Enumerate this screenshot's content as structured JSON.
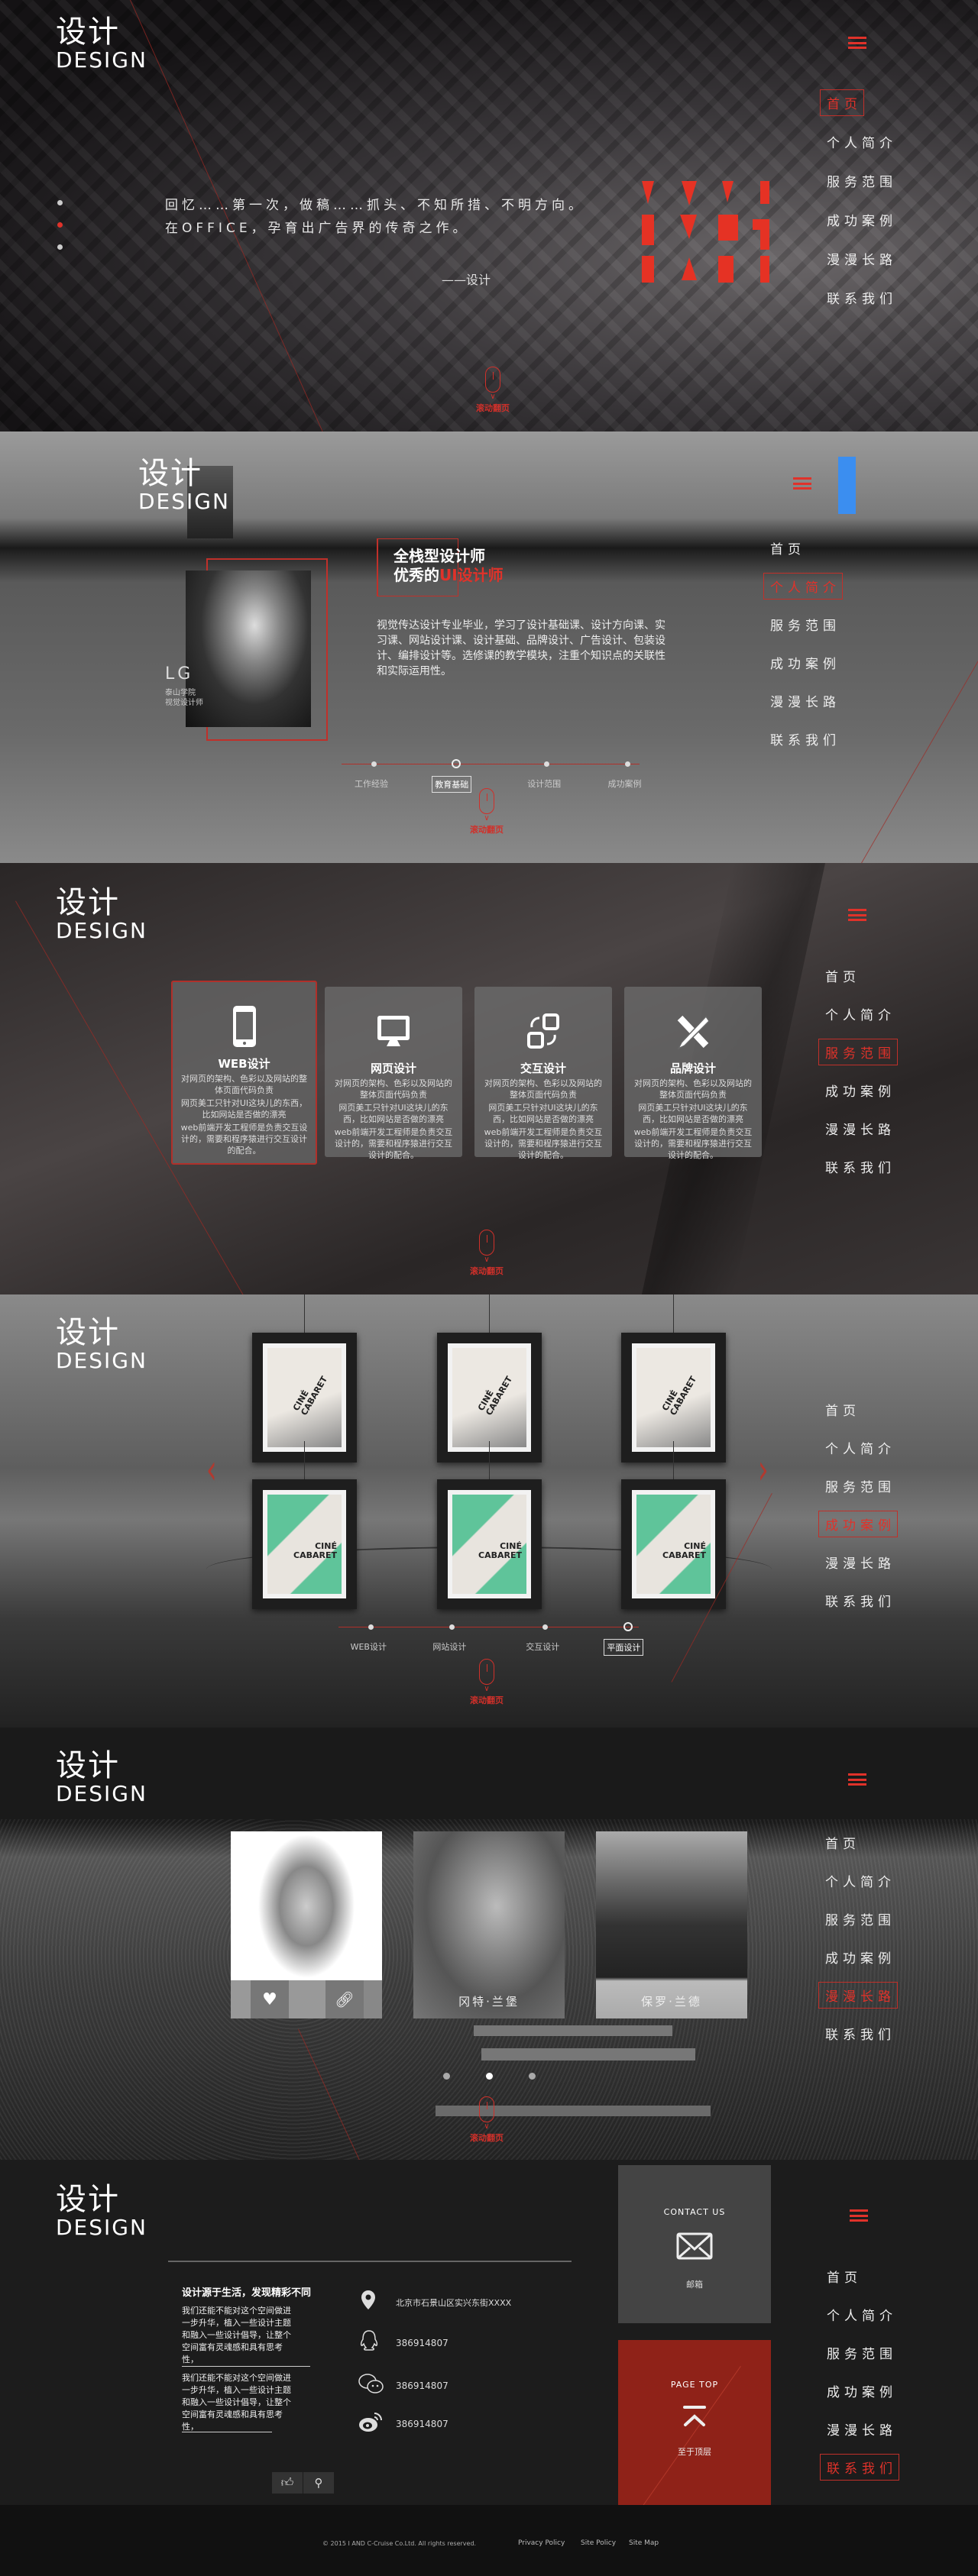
{
  "logo": {
    "cn": "设计",
    "en": "DESIGN"
  },
  "nav": {
    "items": [
      "首页",
      "个人简介",
      "服务范围",
      "成功案例",
      "漫漫长路",
      "联系我们"
    ]
  },
  "scroll_hint": "滚动翻页",
  "colors": {
    "accent": "#e0322a",
    "panel": "#444444",
    "page_top": "#8f2218",
    "indicator": "#3b8ef0"
  },
  "hero": {
    "quote_line1": "回忆……第一次，做稿……抓头、不知所措、不明方向。",
    "quote_line2": "在OFFICE，孕育出广告界的传奇之作。",
    "attribution": "——设计",
    "active_nav": 0
  },
  "profile": {
    "active_nav": 1,
    "name": "LG",
    "school": "泰山学院",
    "role": "视觉设计师",
    "heading_line1": "全栈型设计师",
    "heading_line2_prefix": "优秀的",
    "heading_line2_highlight": "UI设计师",
    "description": "视觉传达设计专业毕业，学习了设计基础课、设计方向课、实习课、网站设计课、设计基础、品牌设计、广告设计、包装设计、编排设计等。选修课的教学模块，注重个知识点的关联性和实际运用性。",
    "timeline": [
      "工作经验",
      "教育基础",
      "设计范围",
      "成功案例"
    ],
    "timeline_current": 1
  },
  "services": {
    "active_nav": 2,
    "cards": [
      {
        "icon": "mobile-phone-icon",
        "title": "WEB设计",
        "lines": [
          "对网页的架构、色彩以及网站的整体页面代码负责",
          "网页美工只针对UI这块儿的东西，比如网站是否做的漂亮",
          "web前端开发工程师是负责交互设计的，需要和程序猿进行交互设计的配合。"
        ]
      },
      {
        "icon": "monitor-icon",
        "title": "网页设计",
        "lines": [
          "对网页的架构、色彩以及网站的整体页面代码负责",
          "网页美工只针对UI这块儿的东西，比如网站是否做的漂亮",
          "web前端开发工程师是负责交互设计的，需要和程序猿进行交互设计的配合。"
        ]
      },
      {
        "icon": "interaction-icon",
        "title": "交互设计",
        "lines": [
          "对网页的架构、色彩以及网站的整体页面代码负责",
          "网页美工只针对UI这块儿的东西，比如网站是否做的漂亮",
          "web前端开发工程师是负责交互设计的，需要和程序猿进行交互设计的配合。"
        ]
      },
      {
        "icon": "pencil-ruler-icon",
        "title": "品牌设计",
        "lines": [
          "对网页的架构、色彩以及网站的整体页面代码负责",
          "网页美工只针对UI这块儿的东西，比如网站是否做的漂亮",
          "web前端开发工程师是负责交互设计的，需要和程序猿进行交互设计的配合。"
        ]
      }
    ],
    "active_card": 0
  },
  "cases": {
    "active_nav": 3,
    "poster_title_1": "CINÉ",
    "poster_title_2": "CABARET",
    "timeline": [
      "WEB设计",
      "网站设计",
      "交互设计",
      "平面设计"
    ],
    "timeline_current": 3
  },
  "designers": {
    "active_nav": 4,
    "people": [
      {
        "name": ""
      },
      {
        "name": "冈特·兰堡"
      },
      {
        "name": "保罗·兰德"
      }
    ],
    "carousel_count": 3,
    "carousel_current": 1
  },
  "contact": {
    "active_nav": 5,
    "slogan": "设计源于生活，发现精彩不同",
    "para1": "我们还能不能对这个空间做进一步升华，植入一些设计主题和融入一些设计倡导，让整个空间富有灵魂感和具有思考性，",
    "para2": "我们还能不能对这个空间做进一步升华，植入一些设计主题和融入一些设计倡导，让整个空间富有灵魂感和具有思考性，",
    "address": "北京市石景山区实兴东街XXXX",
    "qq": "386914807",
    "wechat": "386914807",
    "weibo": "386914807",
    "contact_title": "CONTACT US",
    "contact_label": "邮箱",
    "top_title": "PAGE TOP",
    "top_label": "至于顶层"
  },
  "footer": {
    "copyright": "© 2015 I AND C-Cruise Co.Ltd. All rights reserved.",
    "links": [
      "Privacy Policy",
      "Site Policy",
      "Site Map"
    ]
  }
}
